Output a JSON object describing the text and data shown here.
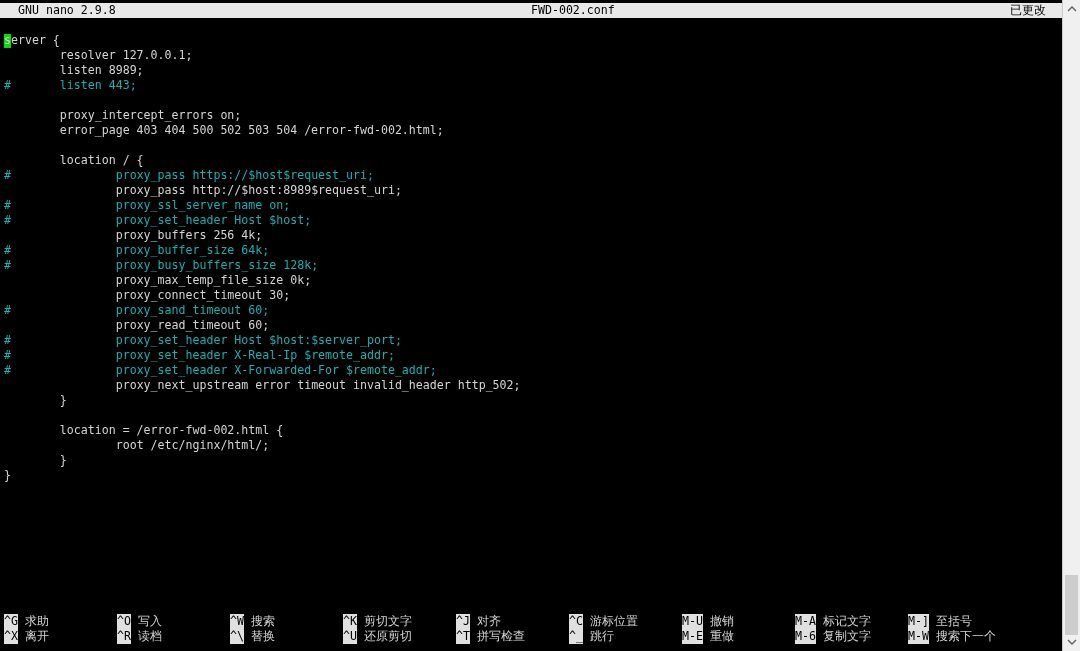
{
  "title_bar": {
    "program": "GNU nano 2.9.8",
    "filename": "FWD-002.conf",
    "status": "已更改"
  },
  "lines": [
    {
      "kind": "code",
      "text": "server {",
      "cursor": true
    },
    {
      "kind": "code",
      "text": "\tresolver 127.0.0.1;",
      "cursor": false
    },
    {
      "kind": "code",
      "text": "\tlisten 8989;",
      "cursor": false
    },
    {
      "kind": "comment",
      "text": "#\tlisten 443;",
      "cursor": false
    },
    {
      "kind": "blank"
    },
    {
      "kind": "code",
      "text": "\tproxy_intercept_errors on;",
      "cursor": false
    },
    {
      "kind": "code",
      "text": "\terror_page 403 404 500 502 503 504 /error-fwd-002.html;",
      "cursor": false
    },
    {
      "kind": "blank"
    },
    {
      "kind": "code",
      "text": "\tlocation / {",
      "cursor": false
    },
    {
      "kind": "comment",
      "text": "#\t\tproxy_pass https://$host$request_uri;",
      "cursor": false
    },
    {
      "kind": "code",
      "text": "\t\tproxy_pass http://$host:8989$request_uri;",
      "cursor": false
    },
    {
      "kind": "comment",
      "text": "#\t\tproxy_ssl_server_name on;",
      "cursor": false
    },
    {
      "kind": "comment",
      "text": "#\t\tproxy_set_header Host $host;",
      "cursor": false
    },
    {
      "kind": "code",
      "text": "\t\tproxy_buffers 256 4k;",
      "cursor": false
    },
    {
      "kind": "comment",
      "text": "#\t\tproxy_buffer_size 64k;",
      "cursor": false
    },
    {
      "kind": "comment",
      "text": "#\t\tproxy_busy_buffers_size 128k;",
      "cursor": false
    },
    {
      "kind": "code",
      "text": "\t\tproxy_max_temp_file_size 0k;",
      "cursor": false
    },
    {
      "kind": "code",
      "text": "\t\tproxy_connect_timeout 30;",
      "cursor": false
    },
    {
      "kind": "comment",
      "text": "#\t\tproxy_sand_timeout 60;",
      "cursor": false
    },
    {
      "kind": "code",
      "text": "\t\tproxy_read_timeout 60;",
      "cursor": false
    },
    {
      "kind": "comment",
      "text": "#\t\tproxy_set_header Host $host:$server_port;",
      "cursor": false
    },
    {
      "kind": "comment",
      "text": "#\t\tproxy_set_header X-Real-Ip $remote_addr;",
      "cursor": false
    },
    {
      "kind": "comment",
      "text": "#\t\tproxy_set_header X-Forwarded-For $remote_addr;",
      "cursor": false
    },
    {
      "kind": "code",
      "text": "\t\tproxy_next_upstream error timeout invalid_header http_502;",
      "cursor": false
    },
    {
      "kind": "code",
      "text": "\t}",
      "cursor": false
    },
    {
      "kind": "blank"
    },
    {
      "kind": "code",
      "text": "\tlocation = /error-fwd-002.html {",
      "cursor": false
    },
    {
      "kind": "code",
      "text": "\t\troot /etc/nginx/html/;",
      "cursor": false
    },
    {
      "kind": "code",
      "text": "\t}",
      "cursor": false
    },
    {
      "kind": "code",
      "text": "}",
      "cursor": false
    }
  ],
  "shortcut_rows": [
    [
      {
        "key": "^G",
        "label": "求助"
      },
      {
        "key": "^O",
        "label": "写入"
      },
      {
        "key": "^W",
        "label": "搜索"
      },
      {
        "key": "^K",
        "label": "剪切文字"
      },
      {
        "key": "^J",
        "label": "对齐"
      },
      {
        "key": "^C",
        "label": "游标位置"
      },
      {
        "key": "M-U",
        "label": "撤销"
      },
      {
        "key": "M-A",
        "label": "标记文字"
      },
      {
        "key": "M-]",
        "label": "至括号"
      }
    ],
    [
      {
        "key": "^X",
        "label": "离开"
      },
      {
        "key": "^R",
        "label": "读档"
      },
      {
        "key": "^\\",
        "label": "替换"
      },
      {
        "key": "^U",
        "label": "还原剪切"
      },
      {
        "key": "^T",
        "label": "拼写检查"
      },
      {
        "key": "^_",
        "label": "跳行"
      },
      {
        "key": "M-E",
        "label": "重做"
      },
      {
        "key": "M-6",
        "label": "复制文字"
      },
      {
        "key": "M-W",
        "label": "搜索下一个"
      }
    ]
  ]
}
